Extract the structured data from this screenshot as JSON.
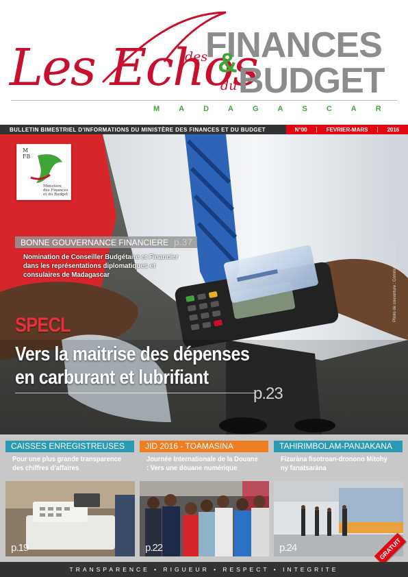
{
  "masthead": {
    "les_echos": "Les Echos",
    "des": "des",
    "du": "du",
    "finances": "FINANCES",
    "amp": "&",
    "budget": "BUDGET",
    "country": "MADAGASCAR"
  },
  "infobar": {
    "bulletin": "BULLETIN BIMESTRIEL D'INFORMATIONS DU MINISTÈRE DES FINANCES ET DU BUDGET",
    "issue": "N°00",
    "period": "FEVRIER-MARS",
    "year": "2016"
  },
  "logo": {
    "abbr_top": "M",
    "abbr_mid": "FB",
    "caption": "Ministère des Finances et du Budget"
  },
  "feature_secondary": {
    "tag": "BONNE GOUVERNANCE FINANCIERE",
    "page": "p.37",
    "text": "Nomination de Conseiller Budgétaire et Financier dans les représentations diplomatiques et consulaires de Madagascar"
  },
  "feature_main": {
    "kicker": "SPECL",
    "headline": "Vers la maitrise des dépenses en carburant et lubrifiant",
    "page": "p.23",
    "credit": "Photo de couverture : Communication DGT"
  },
  "columns": [
    {
      "title": "CAISSES ENREGISTREUSES",
      "text": "Pour une plus grande transparence des chiffres d'affaires",
      "page": "p.19",
      "color": "#2a9bb3"
    },
    {
      "title": "JID 2016 - TOAMASINA",
      "text": "Journée Internationale de la Douane : Vers une douane numérique",
      "page": "p.22",
      "color": "#ef7d22"
    },
    {
      "title": "TAHIRIMBOLAM-PANJAKANA",
      "text": "Fizaràna fisotroan-dronono Mitohy ny fanatsaràna",
      "page": "p.24",
      "color": "#2a9bb3"
    }
  ],
  "badge": "GRATUIT",
  "footer": "TRANSPARENCE • RIGUEUR • RESPECT • INTEGRITE",
  "colors": {
    "brand_red": "#c8102e",
    "brand_green": "#3fa535",
    "brand_grey": "#8c8c8c",
    "accent_red": "#e30613"
  }
}
